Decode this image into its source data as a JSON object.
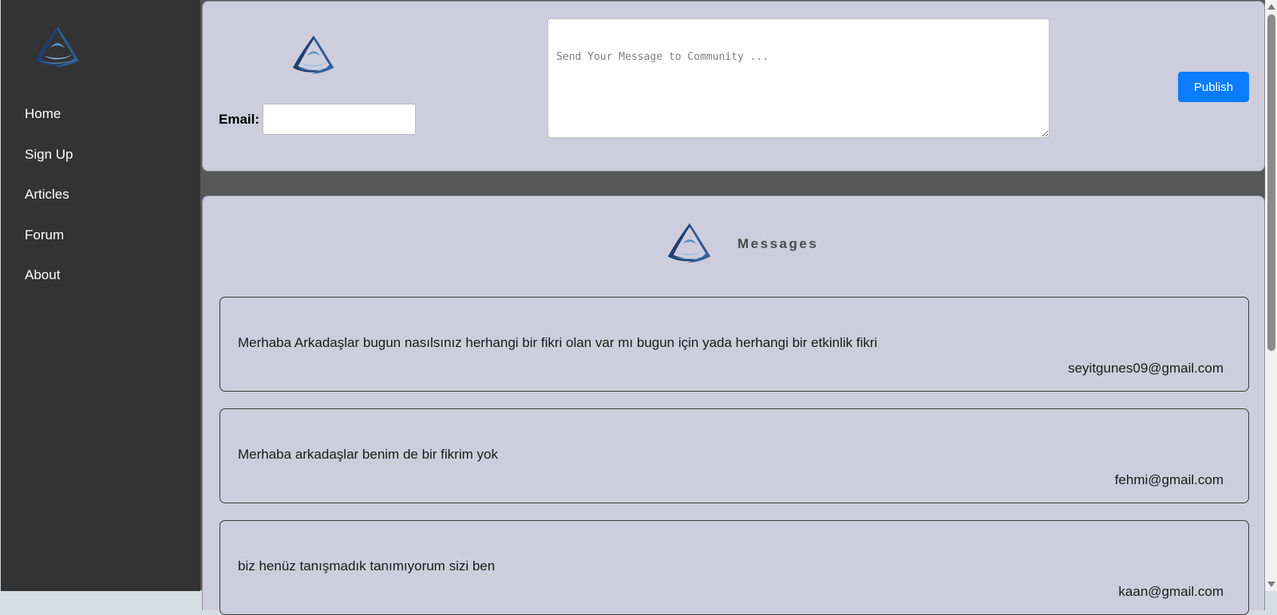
{
  "sidebar": {
    "logo_icon": "triangle-wave-logo-icon",
    "items": [
      {
        "label": "Home"
      },
      {
        "label": "Sign Up"
      },
      {
        "label": "Articles"
      },
      {
        "label": "Forum"
      },
      {
        "label": "About"
      }
    ]
  },
  "composer": {
    "email_label": "Email:",
    "email_value": "",
    "message_placeholder": "Send Your Message to Community ...",
    "message_value": "",
    "publish_label": "Publish"
  },
  "messages": {
    "title": "Messages",
    "items": [
      {
        "text": "Merhaba Arkadaşlar bugun nasılsınız herhangi bir fikri olan var mı bugun için yada herhangi bir etkinlik fikri",
        "email": "seyitgunes09@gmail.com"
      },
      {
        "text": "Merhaba arkadaşlar benim de bir fikrim yok",
        "email": "fehmi@gmail.com"
      },
      {
        "text": "biz henüz tanışmadık tanımıyorum sizi ben",
        "email": "kaan@gmail.com"
      }
    ]
  },
  "colors": {
    "sidebar_bg": "#333333",
    "panel_bg": "#cecddd",
    "gap_bg": "#575757",
    "accent": "#0a7cff"
  }
}
